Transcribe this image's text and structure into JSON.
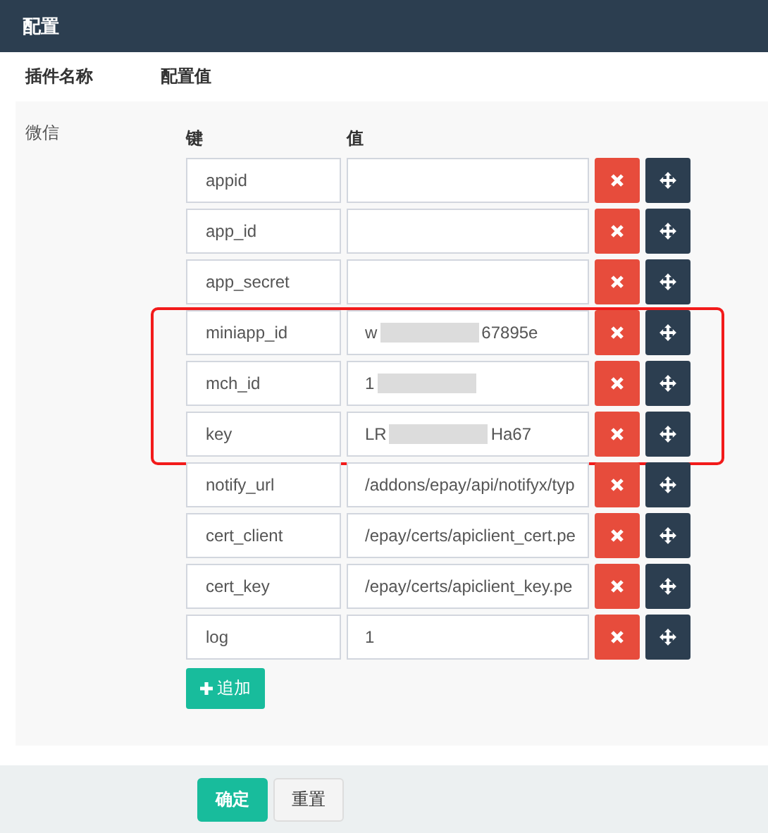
{
  "window": {
    "title": "配置"
  },
  "table": {
    "columns": [
      "插件名称",
      "配置值"
    ],
    "sections": [
      {
        "name": "微信",
        "key_header": "键",
        "value_header": "值",
        "rows": [
          {
            "key": "appid",
            "value": "",
            "highlighted": false
          },
          {
            "key": "app_id",
            "value": "",
            "highlighted": false
          },
          {
            "key": "app_secret",
            "value": "",
            "highlighted": false
          },
          {
            "key": "miniapp_id",
            "value": "w",
            "value_end": "67895e",
            "redacted": true,
            "highlighted": true
          },
          {
            "key": "mch_id",
            "value": "1",
            "redacted": true,
            "highlighted": true
          },
          {
            "key": "key",
            "value": "LR",
            "value_end": "Ha67",
            "redacted": true,
            "highlighted": true
          },
          {
            "key": "notify_url",
            "value": "/addons/epay/api/notifyx/typ",
            "highlighted": false
          },
          {
            "key": "cert_client",
            "value": "/epay/certs/apiclient_cert.pe",
            "highlighted": false
          },
          {
            "key": "cert_key",
            "value": "/epay/certs/apiclient_key.pe",
            "highlighted": false
          },
          {
            "key": "log",
            "value": "1",
            "highlighted": false
          }
        ],
        "add_button": "追加"
      }
    ]
  },
  "footer": {
    "buttons": [
      {
        "label": "确定",
        "kind": "primary"
      },
      {
        "label": "重置",
        "kind": "default"
      }
    ]
  }
}
